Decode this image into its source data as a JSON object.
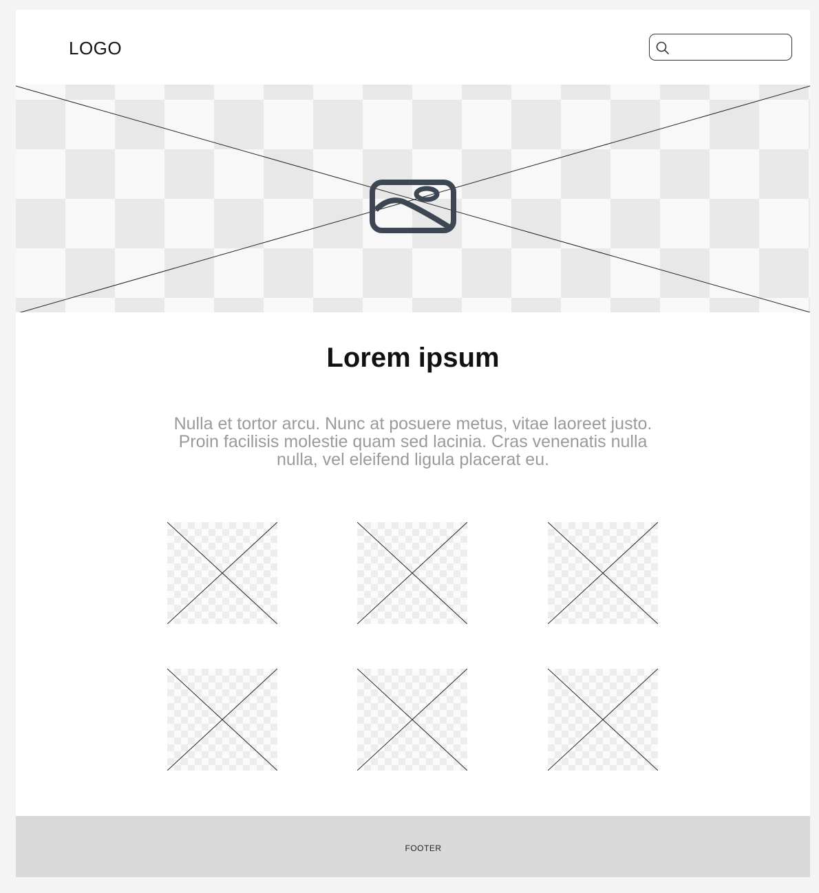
{
  "header": {
    "logo_text": "LOGO",
    "search": {
      "value": "",
      "placeholder": "",
      "icon": "search-icon"
    }
  },
  "hero": {
    "icon": "image-icon"
  },
  "main": {
    "title": "Lorem ipsum",
    "description": "Nulla et tortor arcu. Nunc at posuere metus, vitae laoreet justo. Proin facilisis molestie quam sed lacinia. Cras venenatis nulla nulla, vel eleifend ligula placerat eu."
  },
  "gallery": {
    "item_count": 6,
    "icon": "image-placeholder"
  },
  "footer": {
    "label": "FOOTER"
  },
  "colors": {
    "page_background": "#f4f4f4",
    "content_background": "#ffffff",
    "footer_background": "#d9d9d9",
    "icon_color": "#3d4753",
    "description_color": "#9a9a9a"
  }
}
